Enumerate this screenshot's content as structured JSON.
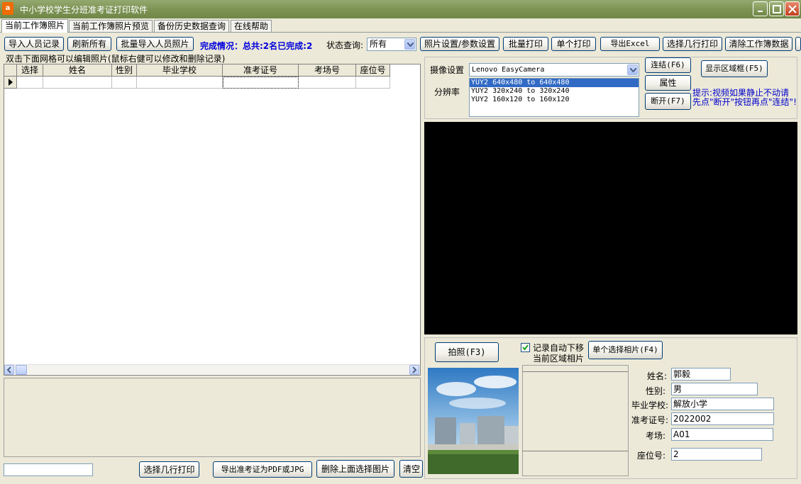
{
  "window": {
    "title": "中小学校学生分班准考证打印软件",
    "icon_letter": "a"
  },
  "tabs": [
    {
      "label": "当前工作簿照片",
      "active": true
    },
    {
      "label": "当前工作簿照片预览",
      "active": false
    },
    {
      "label": "备份历史数据查询",
      "active": false
    },
    {
      "label": "在线帮助",
      "active": false
    }
  ],
  "toolbar": {
    "import_records": "导入人员记录",
    "refresh_all": "刷新所有",
    "batch_import_photos": "批量导入人员照片",
    "completion_status": "完成情况：总共:2名已完成:2",
    "status_query_label": "状态查询:",
    "status_query_value": "所有",
    "photo_settings": "照片设置/参数设置",
    "batch_print": "批量打印",
    "single_print": "单个打印",
    "export_excel": "导出Excel",
    "select_rows_print": "选择几行打印",
    "clear_workbook": "清除工作簿数据"
  },
  "grid": {
    "caption": "双击下面网格可以编辑照片(鼠标右健可以修改和删除记录)",
    "columns": [
      "选择",
      "姓名",
      "性别",
      "毕业学校",
      "准考证号",
      "考场号",
      "座位号"
    ]
  },
  "bottom_left": {
    "select_rows_print": "选择几行打印",
    "export_pdf_jpg": "导出准考证为PDF或JPG",
    "delete_selected_photo": "删除上面选择图片",
    "clear_cut": "清空"
  },
  "camera": {
    "device_label": "摄像设置",
    "device_value": "Lenovo EasyCamera",
    "resolution_label": "分辨率",
    "resolutions": [
      "YUY2 640x480 to 640x480",
      "YUY2 320x240 to 320x240",
      "YUY2 160x120 to 160x120"
    ],
    "selected_resolution": 0,
    "connect": "连结(F6)",
    "properties": "属性",
    "disconnect": "断开(F7)",
    "show_region": "显示区域框(F5)",
    "hint_line1": "提示:视频如果静止不动请",
    "hint_line2": "先点\"断开\"按钮再点\"连结\"!"
  },
  "capture": {
    "shoot": "拍照(F3)",
    "auto_move_label": "记录自动下移",
    "auto_move_checked": true,
    "region_photo_label": "当前区域相片",
    "single_select_photo": "单个选择相片(F4)"
  },
  "record": {
    "name_label": "姓名:",
    "name_value": "郭毅",
    "gender_label": "性别:",
    "gender_value": "男",
    "school_label": "毕业学校:",
    "school_value": "解放小学",
    "ticket_label": "准考证号:",
    "ticket_value": "2022002",
    "room_label": "考场:",
    "room_value": "A01",
    "seat_label": "座位号:",
    "seat_value": "2"
  },
  "colors": {
    "titlebar": "#7d9455",
    "status_blue": "#0000dd",
    "selection": "#316ac5"
  }
}
